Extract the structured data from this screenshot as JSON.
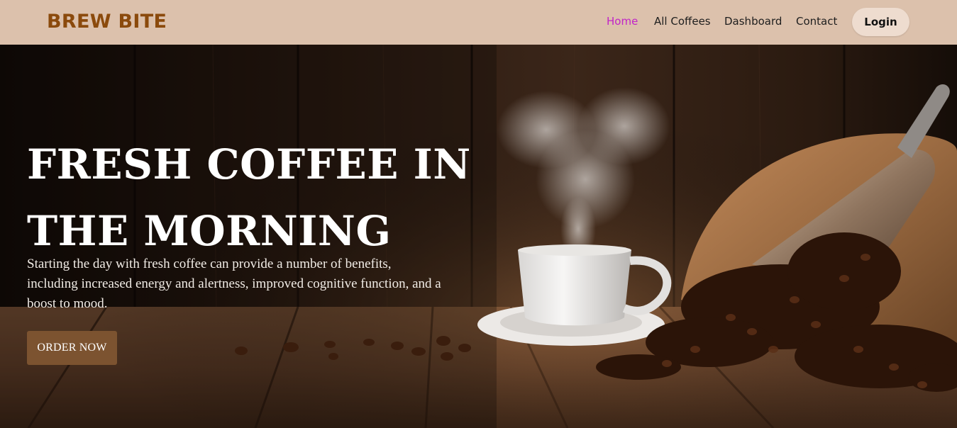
{
  "brand": {
    "name": "BREW BITE",
    "color": "#8b4a0c"
  },
  "nav": {
    "items": [
      {
        "label": "Home",
        "active": true
      },
      {
        "label": "All Coffees",
        "active": false
      },
      {
        "label": "Dashboard",
        "active": false
      },
      {
        "label": "Contact",
        "active": false
      }
    ],
    "login_label": "Login",
    "active_color": "#c124c8",
    "background": "#dcc1ac"
  },
  "hero": {
    "title_line1": "FRESH COFFEE IN",
    "title_line2": "THE MORNING",
    "description": "Starting the day with fresh coffee can provide a number of benefits, including increased energy and alertness, improved cognitive function, and a boost to mood.",
    "cta_label": "ORDER NOW",
    "cta_color": "#7c5330"
  }
}
